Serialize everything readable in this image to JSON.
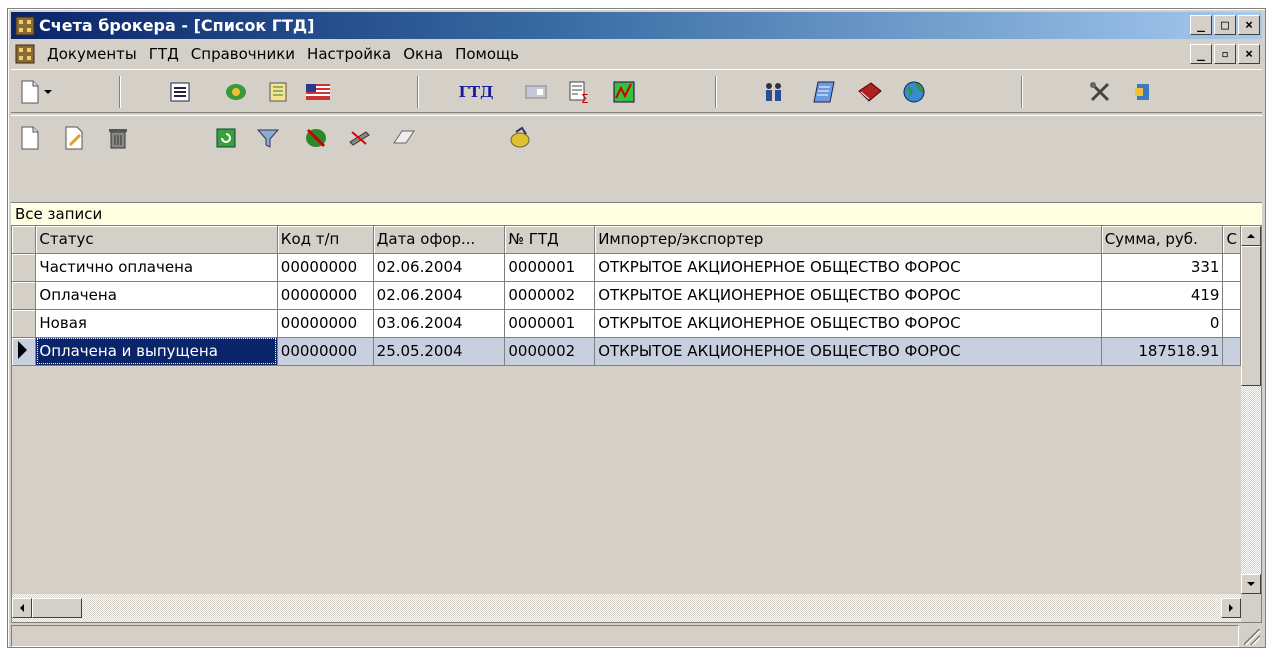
{
  "window": {
    "title": "Счета брокера - [Список ГТД]",
    "controls": [
      "_",
      "□",
      "×"
    ]
  },
  "menubar": {
    "items": [
      "Документы",
      "ГТД",
      "Справочники",
      "Настройка",
      "Окна",
      "Помощь"
    ],
    "child_controls": [
      "_",
      "▫",
      "×"
    ]
  },
  "toolbar1": {
    "gtd_label": "ГТД",
    "icons": [
      "new-document-icon",
      "dropdown-arrow-icon",
      "list-icon",
      "money-icon",
      "book-icon",
      "us-flag-icon",
      "gtd-text-icon",
      "card-icon",
      "sum-report-icon",
      "chart-icon",
      "people-icon",
      "notebook-icon",
      "red-book-icon",
      "globe-icon",
      "tools-icon",
      "exit-icon"
    ]
  },
  "toolbar2": {
    "icons": [
      "new-record-icon",
      "edit-record-icon",
      "delete-trash-icon",
      "refresh-icon",
      "filter-icon",
      "money-cancel-icon",
      "pen-cross-icon",
      "eraser-icon",
      "coin-icon"
    ]
  },
  "filter": {
    "label": "Все записи"
  },
  "grid": {
    "columns": [
      "Статус",
      "Код т/п",
      "Дата офор...",
      "№ ГТД",
      "Импортер/экспортер",
      "Сумма, руб.",
      "С"
    ],
    "rows": [
      {
        "status": "Частично оплачена",
        "code": "00000000",
        "date": "02.06.2004",
        "num": "0000001",
        "importer": "ОТКРЫТОЕ АКЦИОНЕРНОЕ ОБЩЕСТВО ФОРОС",
        "sum": "331"
      },
      {
        "status": "Оплачена",
        "code": "00000000",
        "date": "02.06.2004",
        "num": "0000002",
        "importer": "ОТКРЫТОЕ АКЦИОНЕРНОЕ ОБЩЕСТВО ФОРОС",
        "sum": "419"
      },
      {
        "status": "Новая",
        "code": "00000000",
        "date": "03.06.2004",
        "num": "0000001",
        "importer": "ОТКРЫТОЕ АКЦИОНЕРНОЕ ОБЩЕСТВО ФОРОС",
        "sum": "0"
      },
      {
        "status": "Оплачена и выпущена",
        "code": "00000000",
        "date": "25.05.2004",
        "num": "0000002",
        "importer": "ОТКРЫТОЕ АКЦИОНЕРНОЕ ОБЩЕСТВО ФОРОС",
        "sum": "187518.91"
      }
    ],
    "selected_row": 3
  },
  "colors": {
    "title_start": "#0a246a",
    "title_end": "#a6caf0",
    "face": "#d4d0c8",
    "filter_bg": "#ffffe1",
    "selection": "#0a246a"
  }
}
